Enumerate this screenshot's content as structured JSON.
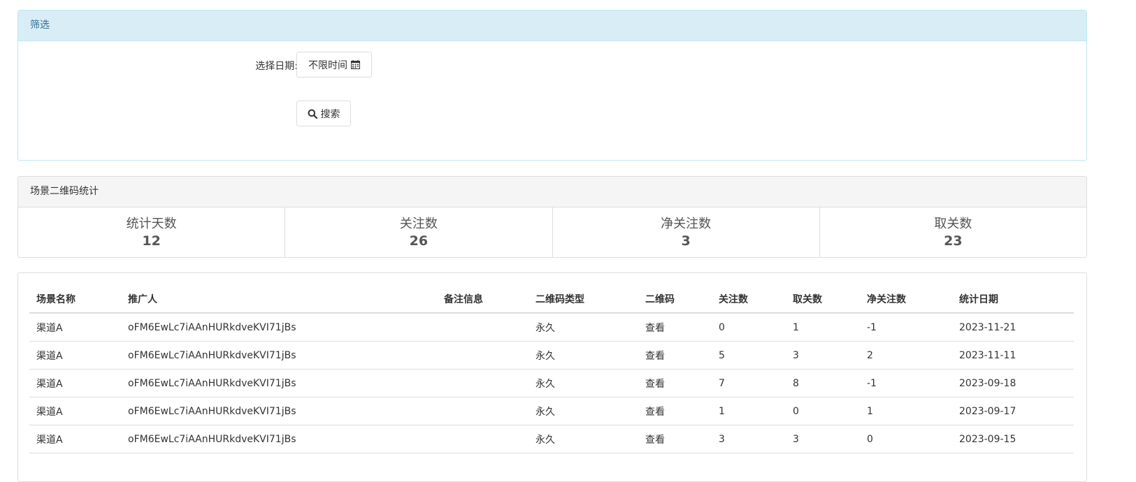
{
  "filter": {
    "title": "筛选",
    "date_label": "选择日期:",
    "date_button_label": "不限时间",
    "search_button_label": "搜索"
  },
  "stats": {
    "title": "场景二维码统计",
    "items": [
      {
        "label": "统计天数",
        "value": "12"
      },
      {
        "label": "关注数",
        "value": "26"
      },
      {
        "label": "净关注数",
        "value": "3"
      },
      {
        "label": "取关数",
        "value": "23"
      }
    ]
  },
  "table": {
    "headers": [
      "场景名称",
      "推广人",
      "备注信息",
      "二维码类型",
      "二维码",
      "关注数",
      "取关数",
      "净关注数",
      "统计日期"
    ],
    "rows": [
      [
        "渠道A",
        "oFM6EwLc7iAAnHURkdveKVI71jBs",
        "",
        "永久",
        "查看",
        "0",
        "1",
        "-1",
        "2023-11-21"
      ],
      [
        "渠道A",
        "oFM6EwLc7iAAnHURkdveKVI71jBs",
        "",
        "永久",
        "查看",
        "5",
        "3",
        "2",
        "2023-11-11"
      ],
      [
        "渠道A",
        "oFM6EwLc7iAAnHURkdveKVI71jBs",
        "",
        "永久",
        "查看",
        "7",
        "8",
        "-1",
        "2023-09-18"
      ],
      [
        "渠道A",
        "oFM6EwLc7iAAnHURkdveKVI71jBs",
        "",
        "永久",
        "查看",
        "1",
        "0",
        "1",
        "2023-09-17"
      ],
      [
        "渠道A",
        "oFM6EwLc7iAAnHURkdveKVI71jBs",
        "",
        "永久",
        "查看",
        "3",
        "3",
        "0",
        "2023-09-15"
      ]
    ]
  },
  "icons": {
    "calendar": "calendar-icon",
    "search": "search-icon"
  },
  "colors": {
    "filter_heading_bg": "#d9edf7",
    "filter_heading_text": "#31708f",
    "stats_heading_bg": "#f5f5f5",
    "border": "#dddddd"
  }
}
